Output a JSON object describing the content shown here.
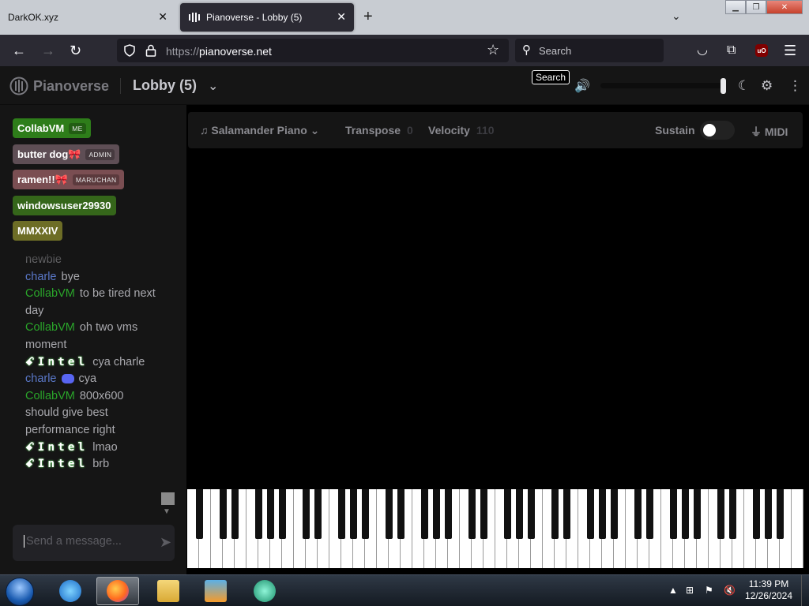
{
  "browser": {
    "tabs": [
      {
        "title": "DarkOK.xyz"
      },
      {
        "title": "Pianoverse - Lobby (5)"
      }
    ],
    "url_scheme": "https://",
    "url_host": "pianoverse.net",
    "search_label": "Search",
    "search_tooltip": "Search",
    "ublock_label": "uO"
  },
  "app": {
    "brand": "Pianoverse",
    "room": "Lobby (5)",
    "volume_level": 1.0
  },
  "users": [
    {
      "name": "CollabVM",
      "tag": "ME",
      "color": "#2e7d1a"
    },
    {
      "name": "butter dog🎀",
      "tag": "ADMIN",
      "color": "#5e4e55"
    },
    {
      "name": "ramen!!🎀",
      "tag": "MARUCHAN",
      "color": "#7a4e52"
    },
    {
      "name": "windowsuser29930",
      "tag": "",
      "color": "#35661a"
    },
    {
      "name": "MMXXIV",
      "tag": "",
      "color": "#6d6d26"
    }
  ],
  "chat": {
    "messages": [
      {
        "nick": "",
        "text": "newbie",
        "kind": "plain"
      },
      {
        "nick": "charle",
        "text": "bye",
        "kind": "charle"
      },
      {
        "nick": "CollabVM",
        "text": "to be tired next day",
        "kind": "collab"
      },
      {
        "nick": "CollabVM",
        "text": "oh two vms moment",
        "kind": "collab"
      },
      {
        "nick": "ꗃIntel",
        "text": "cya charle",
        "kind": "intel"
      },
      {
        "nick": "charle",
        "text": "cya",
        "kind": "charle-discord"
      },
      {
        "nick": "CollabVM",
        "text": "800x600 should give best performance right",
        "kind": "collab"
      },
      {
        "nick": "ꗃIntel",
        "text": "lmao",
        "kind": "intel"
      },
      {
        "nick": "ꗃIntel",
        "text": "brb",
        "kind": "intel"
      }
    ],
    "input_placeholder": "Send a message..."
  },
  "toolbar": {
    "instrument": "Salamander Piano",
    "transpose_label": "Transpose",
    "transpose_value": "0",
    "velocity_label": "Velocity",
    "velocity_value": "110",
    "sustain_label": "Sustain",
    "sustain_on": false,
    "midi_label": "MIDI"
  },
  "taskbar": {
    "time": "11:39 PM",
    "date": "12/26/2024"
  }
}
